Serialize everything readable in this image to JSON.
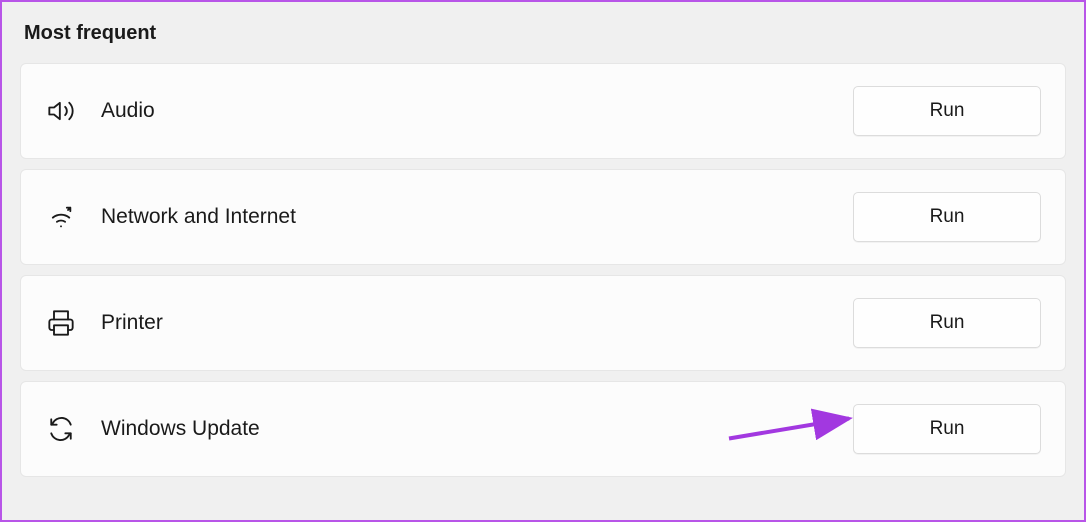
{
  "section": {
    "title": "Most frequent"
  },
  "items": [
    {
      "icon": "volume-icon",
      "label": "Audio",
      "button": "Run"
    },
    {
      "icon": "wifi-icon",
      "label": "Network and Internet",
      "button": "Run"
    },
    {
      "icon": "printer-icon",
      "label": "Printer",
      "button": "Run"
    },
    {
      "icon": "refresh-icon",
      "label": "Windows Update",
      "button": "Run"
    }
  ],
  "annotation": {
    "target_index": 3,
    "type": "arrow",
    "color": "#a238e0"
  }
}
